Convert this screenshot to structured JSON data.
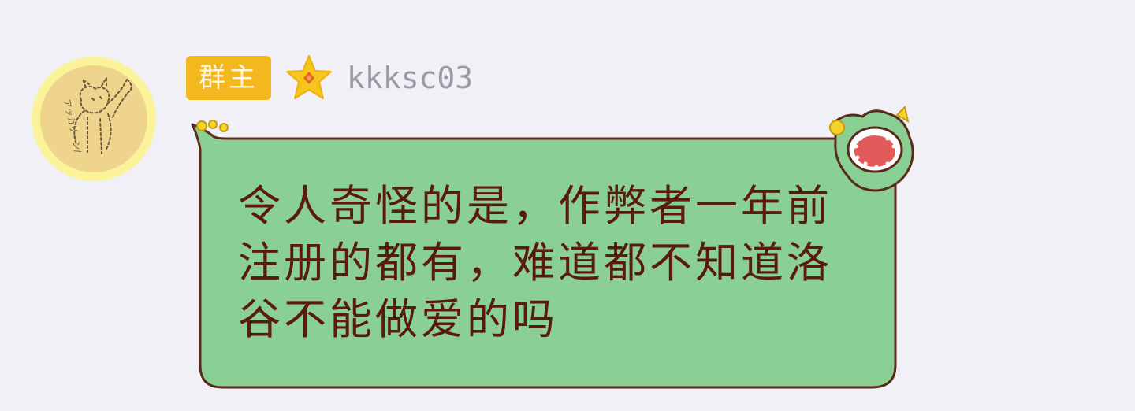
{
  "sender": {
    "role_badge": "群主",
    "username": "kkksc03",
    "avatar": {
      "icon": "sketch-cat-avatar",
      "caption": "アッカリーン/"
    }
  },
  "message": {
    "text": "令人奇怪的是，作弊者一年前注册的都有，难道都不知道洛谷不能做爱的吗"
  },
  "colors": {
    "page_background": "#f0f0f6",
    "badge_background": "#f2b81e",
    "badge_text": "#fff7e0",
    "star": "#f6c61c",
    "username": "#9b9ba6",
    "bubble_fill": "#8ad094",
    "bubble_outline": "#5a2a1a",
    "message_text": "#5a1a10"
  }
}
